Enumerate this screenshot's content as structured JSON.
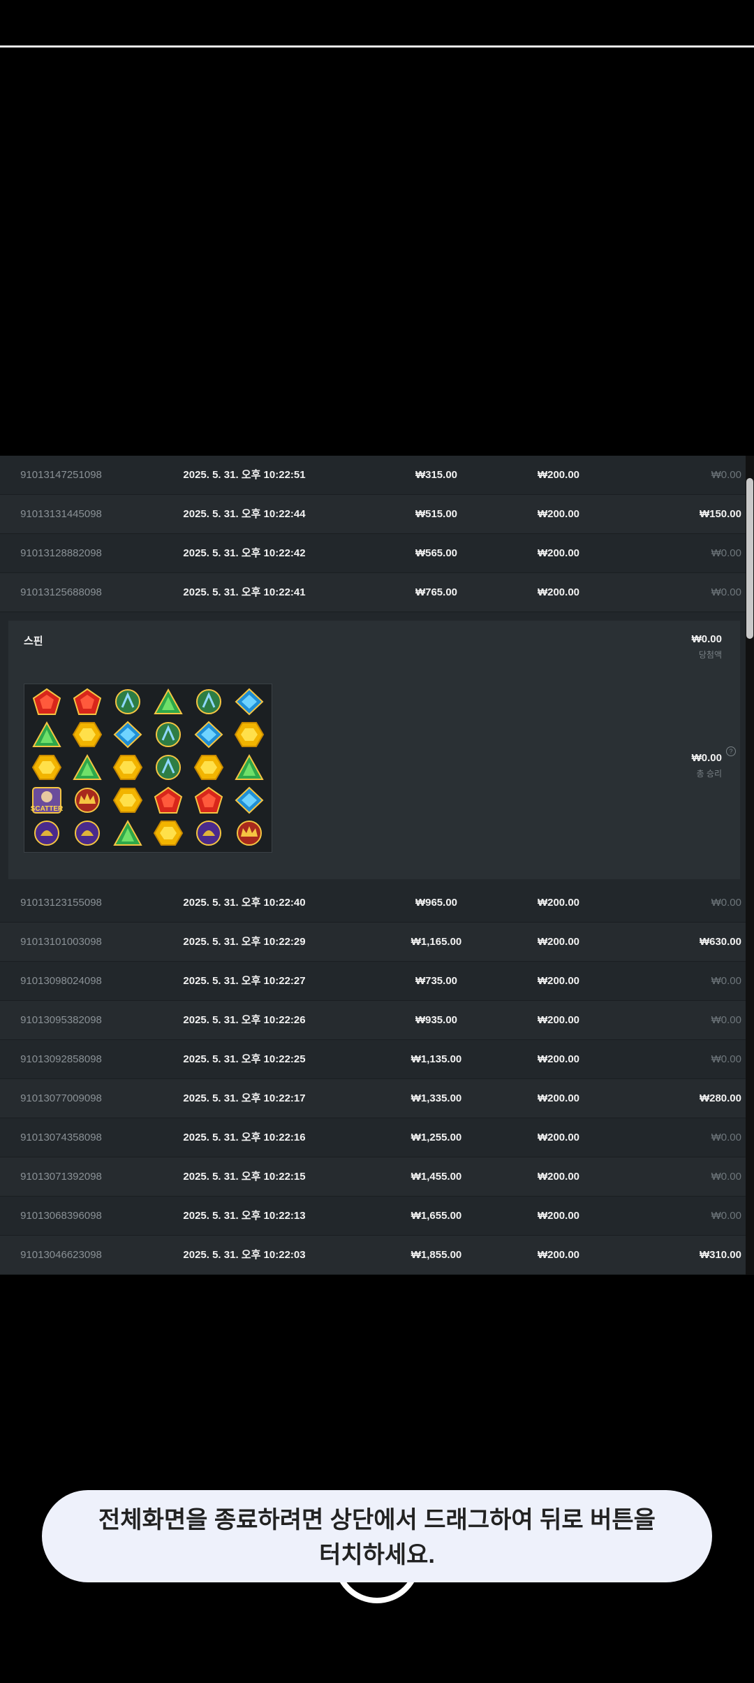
{
  "rows_top": [
    {
      "id": "91013147251098",
      "time": "2025. 5. 31. 오후 10:22:51",
      "balance": "₩315.00",
      "bet": "₩200.00",
      "win": "₩0.00",
      "win_dim": true
    },
    {
      "id": "91013131445098",
      "time": "2025. 5. 31. 오후 10:22:44",
      "balance": "₩515.00",
      "bet": "₩200.00",
      "win": "₩150.00",
      "win_dim": false
    },
    {
      "id": "91013128882098",
      "time": "2025. 5. 31. 오후 10:22:42",
      "balance": "₩565.00",
      "bet": "₩200.00",
      "win": "₩0.00",
      "win_dim": true
    },
    {
      "id": "91013125688098",
      "time": "2025. 5. 31. 오후 10:22:41",
      "balance": "₩765.00",
      "bet": "₩200.00",
      "win": "₩0.00",
      "win_dim": true
    }
  ],
  "detail": {
    "spin_label": "스핀",
    "win_amount": "₩0.00",
    "win_label": "당첨액",
    "total_amount": "₩0.00",
    "total_label": "총 승리",
    "help_icon": "?",
    "grid": [
      [
        "red",
        "red",
        "green-orb",
        "green",
        "green-orb",
        "blue"
      ],
      [
        "green",
        "yellow",
        "blue",
        "green-orb",
        "blue",
        "yellow"
      ],
      [
        "yellow",
        "green",
        "yellow",
        "green-orb",
        "yellow",
        "green"
      ],
      [
        "scatter",
        "crown",
        "yellow",
        "red",
        "red",
        "blue"
      ],
      [
        "purple",
        "purple",
        "green",
        "yellow",
        "purple",
        "crown"
      ]
    ],
    "scatter_text": "SCATTER"
  },
  "rows_bottom": [
    {
      "id": "91013123155098",
      "time": "2025. 5. 31. 오후 10:22:40",
      "balance": "₩965.00",
      "bet": "₩200.00",
      "win": "₩0.00",
      "win_dim": true
    },
    {
      "id": "91013101003098",
      "time": "2025. 5. 31. 오후 10:22:29",
      "balance": "₩1,165.00",
      "bet": "₩200.00",
      "win": "₩630.00",
      "win_dim": false
    },
    {
      "id": "91013098024098",
      "time": "2025. 5. 31. 오후 10:22:27",
      "balance": "₩735.00",
      "bet": "₩200.00",
      "win": "₩0.00",
      "win_dim": true
    },
    {
      "id": "91013095382098",
      "time": "2025. 5. 31. 오후 10:22:26",
      "balance": "₩935.00",
      "bet": "₩200.00",
      "win": "₩0.00",
      "win_dim": true
    },
    {
      "id": "91013092858098",
      "time": "2025. 5. 31. 오후 10:22:25",
      "balance": "₩1,135.00",
      "bet": "₩200.00",
      "win": "₩0.00",
      "win_dim": true
    },
    {
      "id": "91013077009098",
      "time": "2025. 5. 31. 오후 10:22:17",
      "balance": "₩1,335.00",
      "bet": "₩200.00",
      "win": "₩280.00",
      "win_dim": false
    },
    {
      "id": "91013074358098",
      "time": "2025. 5. 31. 오후 10:22:16",
      "balance": "₩1,255.00",
      "bet": "₩200.00",
      "win": "₩0.00",
      "win_dim": true
    },
    {
      "id": "91013071392098",
      "time": "2025. 5. 31. 오후 10:22:15",
      "balance": "₩1,455.00",
      "bet": "₩200.00",
      "win": "₩0.00",
      "win_dim": true
    },
    {
      "id": "91013068396098",
      "time": "2025. 5. 31. 오후 10:22:13",
      "balance": "₩1,655.00",
      "bet": "₩200.00",
      "win": "₩0.00",
      "win_dim": true
    },
    {
      "id": "91013046623098",
      "time": "2025. 5. 31. 오후 10:22:03",
      "balance": "₩1,855.00",
      "bet": "₩200.00",
      "win": "₩310.00",
      "win_dim": false
    }
  ],
  "toast": {
    "line1": "전체화면을 종료하려면 상단에서 드래그하여 뒤로 버튼을",
    "line2": "터치하세요."
  },
  "colors": {
    "panel": "#22272b",
    "detail": "#2a3034",
    "dim": "#6e767b",
    "toast_bg": "#eef1fb"
  }
}
